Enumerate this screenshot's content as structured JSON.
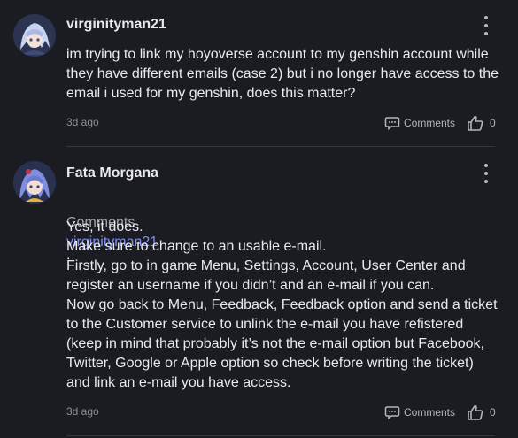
{
  "comments": [
    {
      "username": "virginityman21",
      "text": "im trying to link my hoyoverse account to my genshin account while\nthey have different emails (case 2) but i no longer have access to the\nemail i used for my genshin, does this matter?",
      "time": "3d ago",
      "comments_label": "Comments",
      "likes": "0"
    },
    {
      "username": "Fata Morgana",
      "reply_prefix": "Comments",
      "reply_to": "virginityman21",
      "reply_colon": ":",
      "text": "Yes, it does.\nMake sure to change to an usable e-mail.\nFirstly, go to in game Menu, Settings, Account, User Center and\nregister an username if you didn’t and an e-mail if you can.\nNow go back to Menu, Feedback, Feedback option and send a ticket\nto the Customer service to unlink the e-mail you have refistered\n(keep in mind that probably it’s not the e-mail option but Facebook,\nTwitter, Google or Apple option so check before writing the ticket)\nand link an e-mail you have access.",
      "time": "3d ago",
      "comments_label": "Comments",
      "likes": "0"
    }
  ],
  "colors": {
    "background": "#1b1c22",
    "mention": "#7e8ff0",
    "divider": "#34353d"
  },
  "icons": [
    "avatar-image",
    "more-vertical-icon",
    "comment-bubble-icon",
    "thumbs-up-icon"
  ]
}
